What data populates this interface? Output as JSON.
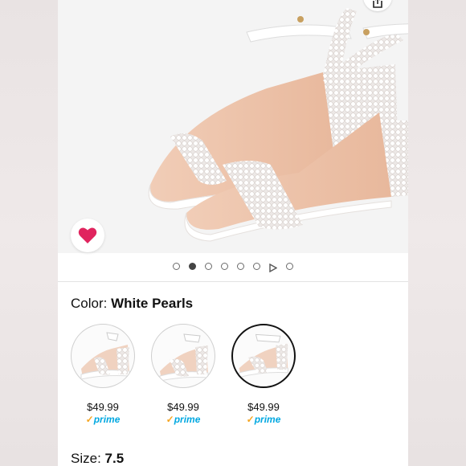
{
  "product": {
    "image_alt": "White pearl block heel ankle strap sandals",
    "carousel": {
      "count": 8,
      "active_index": 1,
      "video_index": 6
    }
  },
  "color": {
    "label": "Color:",
    "selected": "White Pearls",
    "options": [
      {
        "price": "$49.99",
        "prime": "prime"
      },
      {
        "price": "$49.99",
        "prime": "prime"
      },
      {
        "price": "$49.99",
        "prime": "prime"
      }
    ],
    "selected_index": 2
  },
  "size": {
    "label": "Size:",
    "selected": "7.5"
  },
  "icons": {
    "share": "share-icon",
    "wishlist": "heart-icon"
  },
  "colors": {
    "heart": "#e0245e",
    "prime": "#00a8e1",
    "prime_check": "#f5a623"
  }
}
